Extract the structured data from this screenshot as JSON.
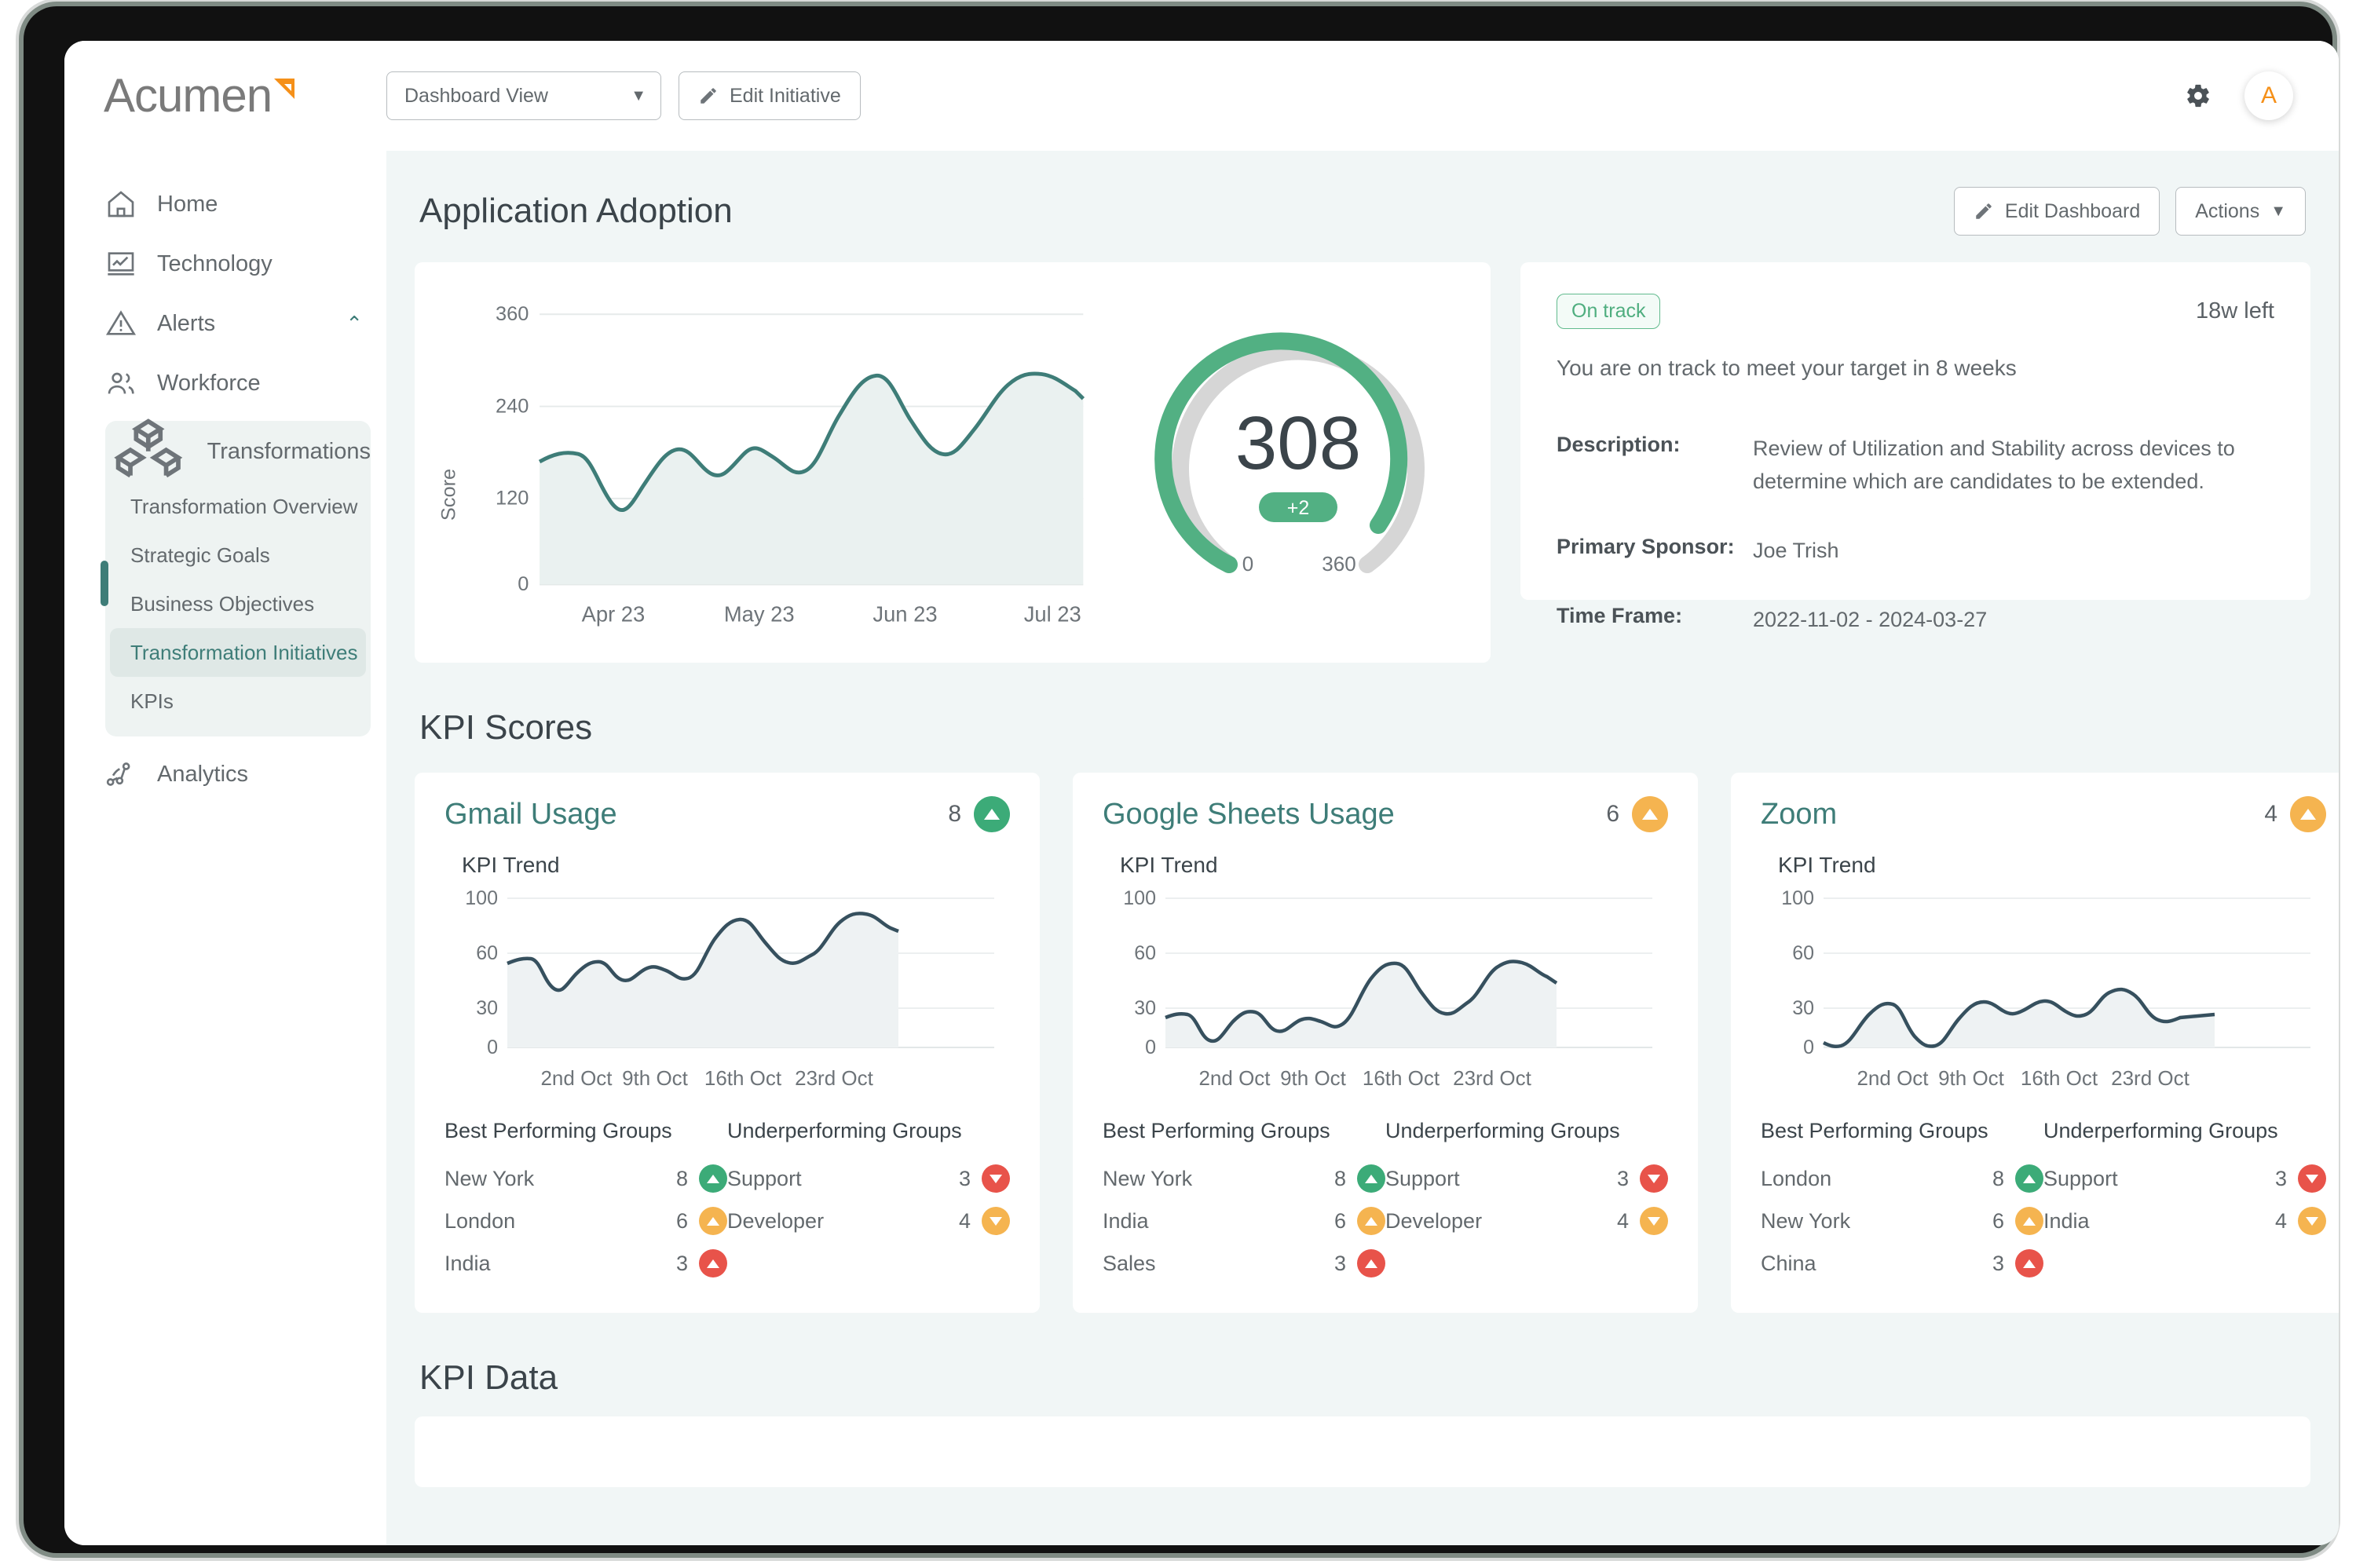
{
  "brand": {
    "name": "Acumen",
    "logo_mark": "triangle-mark",
    "accent": "#f59019"
  },
  "topbar": {
    "view_select": {
      "value": "Dashboard View",
      "caret": "chevron-down-icon"
    },
    "edit_initiative_label": "Edit Initiative",
    "settings_icon": "gear-icon",
    "avatar_initial": "A"
  },
  "sidebar": {
    "items": [
      {
        "label": "Home",
        "icon": "home-icon"
      },
      {
        "label": "Technology",
        "icon": "monitor-chart-icon"
      },
      {
        "label": "Alerts",
        "icon": "warning-triangle-icon",
        "chevron": "chevron-up-icon"
      },
      {
        "label": "Workforce",
        "icon": "people-icon"
      }
    ],
    "group": {
      "label": "Transformations",
      "icon": "cubes-icon",
      "sub_items": [
        {
          "label": "Transformation Overview",
          "active": false
        },
        {
          "label": "Strategic Goals",
          "active": false
        },
        {
          "label": "Business Objectives",
          "active": false
        },
        {
          "label": "Transformation Initiatives",
          "active": true
        },
        {
          "label": "KPIs",
          "active": false
        }
      ]
    },
    "footer_item": {
      "label": "Analytics",
      "icon": "network-nodes-icon"
    }
  },
  "dashboard": {
    "title": "Application Adoption",
    "edit_dashboard_label": "Edit Dashboard",
    "actions_label": "Actions",
    "actions_caret": "chevron-down-icon"
  },
  "initiative": {
    "status_chip": "On track",
    "time_left": "18w left",
    "subtitle": "You are on track to meet your target in 8 weeks",
    "fields": [
      {
        "key": "Description:",
        "value": "Review of Utilization and Stability across devices to determine which are candidates to be extended."
      },
      {
        "key": "Primary Sponsor:",
        "value": "Joe Trish"
      },
      {
        "key": "Time Frame:",
        "value": "2022-11-02 - 2024-03-27"
      }
    ],
    "colors": {
      "on_track": "#4fae7f",
      "gauge": "#52b083",
      "gauge_track": "#d6d6d6"
    }
  },
  "sections": {
    "kpi_scores_title": "KPI Scores",
    "kpi_data_title": "KPI Data"
  },
  "chart_data": [
    {
      "id": "adoption-score-trend",
      "type": "area",
      "title": "",
      "xlabel": "",
      "ylabel": "Score",
      "ylim": [
        0,
        360
      ],
      "yticks": [
        0,
        120,
        240,
        360
      ],
      "xticks": [
        "Apr 23",
        "May 23",
        "Jun 23",
        "Jul 23"
      ],
      "grid": true,
      "line_color": "#3e7d78",
      "fill_color": "#eaf1f0",
      "x": [
        0,
        0.05,
        0.1,
        0.16,
        0.22,
        0.28,
        0.34,
        0.4,
        0.46,
        0.52,
        0.58,
        0.64,
        0.7,
        0.76,
        0.82,
        0.88,
        0.94,
        1.0
      ],
      "values": [
        168,
        178,
        155,
        118,
        140,
        175,
        150,
        148,
        172,
        150,
        148,
        175,
        215,
        240,
        210,
        182,
        178,
        230,
        242,
        238
      ]
    },
    {
      "id": "adoption-gauge",
      "type": "gauge",
      "value": 308,
      "delta": "+2",
      "min_label": "0",
      "max_label": "360",
      "range": [
        0,
        360
      ],
      "arc_color": "#52b083",
      "track_color": "#d6d6d6"
    },
    {
      "id": "gmail-usage-trend",
      "type": "area",
      "title": "KPI Trend",
      "ylim": [
        0,
        100
      ],
      "yticks": [
        0,
        30,
        60,
        100
      ],
      "xticks": [
        "2nd Oct",
        "9th Oct",
        "16th Oct",
        "23rd Oct"
      ],
      "line_color": "#36505e",
      "fill_color": "#eef2f3",
      "values": [
        53,
        56,
        46,
        37,
        44,
        55,
        52,
        48,
        50,
        54,
        50,
        48,
        55,
        70,
        84,
        86,
        78,
        66,
        59,
        58,
        68,
        84,
        91,
        92,
        86
      ]
    },
    {
      "id": "google-sheets-usage-trend",
      "type": "area",
      "title": "KPI Trend",
      "ylim": [
        0,
        100
      ],
      "yticks": [
        0,
        30,
        60,
        100
      ],
      "xticks": [
        "2nd Oct",
        "9th Oct",
        "16th Oct",
        "23rd Oct"
      ],
      "line_color": "#36505e",
      "fill_color": "#eef2f3",
      "values": [
        19,
        21,
        14,
        5,
        10,
        19,
        21,
        15,
        14,
        19,
        20,
        16,
        17,
        26,
        38,
        45,
        46,
        38,
        30,
        24,
        23,
        32,
        43,
        47,
        45
      ]
    },
    {
      "id": "zoom-usage-trend",
      "type": "area",
      "title": "KPI Trend",
      "ylim": [
        0,
        100
      ],
      "yticks": [
        0,
        30,
        60,
        100
      ],
      "xticks": [
        "2nd Oct",
        "9th Oct",
        "16th Oct",
        "23rd Oct"
      ],
      "line_color": "#36505e",
      "fill_color": "#eef2f3",
      "values": [
        2,
        0,
        6,
        16,
        24,
        25,
        18,
        10,
        2,
        1,
        9,
        20,
        29,
        33,
        29,
        28,
        33,
        31,
        27,
        33,
        40,
        41,
        34,
        28,
        29
      ]
    }
  ],
  "kpi_cards": [
    {
      "title": "Gmail Usage",
      "score": "8",
      "score_direction": "up",
      "score_color": "#4fae7f",
      "trend_label": "KPI Trend",
      "chart_id": "gmail-usage-trend",
      "best_header": "Best Performing Groups",
      "under_header": "Underperforming Groups",
      "best": [
        {
          "name": "New York",
          "value": "8",
          "direction": "up",
          "color": "#3cab78"
        },
        {
          "name": "London",
          "value": "6",
          "direction": "up",
          "color": "#f5b košt"
        },
        {
          "name": "India",
          "value": "3",
          "direction": "up",
          "color": "#e8534a"
        }
      ],
      "under": [
        {
          "name": "Support",
          "value": "3",
          "direction": "down",
          "color": "#e8534a"
        },
        {
          "name": "Developer",
          "value": "4",
          "direction": "down",
          "color": "#f5b450"
        }
      ]
    },
    {
      "title": "Google Sheets Usage",
      "score": "6",
      "score_direction": "up",
      "score_color": "#f5b450",
      "trend_label": "KPI Trend",
      "chart_id": "google-sheets-usage-trend",
      "best_header": "Best Performing Groups",
      "under_header": "Underperforming Groups",
      "best": [
        {
          "name": "New York",
          "value": "8",
          "direction": "up",
          "color": "#3cab78"
        },
        {
          "name": "India",
          "value": "6",
          "direction": "up",
          "color": "#f5b450"
        },
        {
          "name": "Sales",
          "value": "3",
          "direction": "up",
          "color": "#e8534a"
        }
      ],
      "under": [
        {
          "name": "Support",
          "value": "3",
          "direction": "down",
          "color": "#e8534a"
        },
        {
          "name": "Developer",
          "value": "4",
          "direction": "down",
          "color": "#f5b450"
        }
      ]
    },
    {
      "title": "Zoom",
      "score": "4",
      "score_direction": "up",
      "score_color": "#f5b450",
      "trend_label": "KPI Trend",
      "chart_id": "zoom-usage-trend",
      "best_header": "Best Performing Groups",
      "under_header": "Underperforming Groups",
      "best": [
        {
          "name": "London",
          "value": "8",
          "direction": "up",
          "color": "#3cab78"
        },
        {
          "name": "New York",
          "value": "6",
          "direction": "up",
          "color": "#f5b450"
        },
        {
          "name": "China",
          "value": "3",
          "direction": "up",
          "color": "#e8534a"
        }
      ],
      "under": [
        {
          "name": "Support",
          "value": "3",
          "direction": "down",
          "color": "#e8534a"
        },
        {
          "name": "India",
          "value": "4",
          "direction": "down",
          "color": "#f5b450"
        }
      ]
    }
  ]
}
